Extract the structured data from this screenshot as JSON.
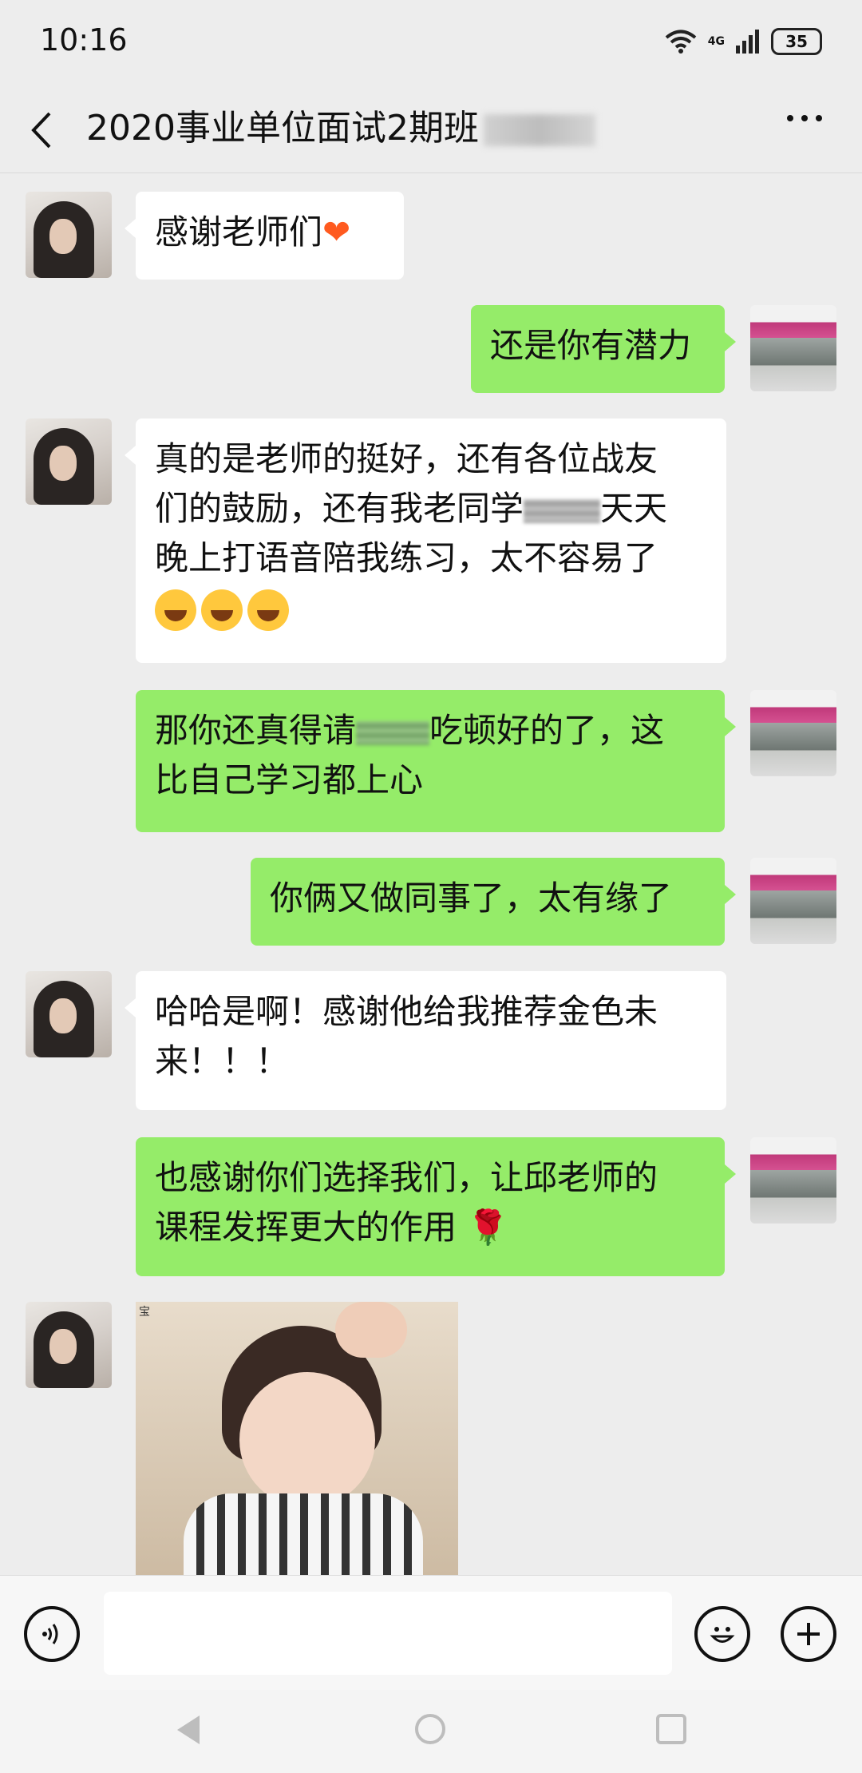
{
  "status_bar": {
    "time": "10:16",
    "network": "4G",
    "battery": "35"
  },
  "header": {
    "title": "2020事业单位面试2期班",
    "back_icon": "back-arrow-icon",
    "more_icon": "more-icon"
  },
  "messages": [
    {
      "side": "left",
      "text": "感谢老师们",
      "emoji": "orange-heart"
    },
    {
      "side": "right",
      "text": "还是你有潜力"
    },
    {
      "side": "left",
      "lines": [
        "真的是老师的挺好，还有各位战友",
        "们的鼓励，还有我老同学",
        "天天",
        "晚上打语音陪我练习，太不容易了"
      ],
      "emoji": "tears-of-joy x3"
    },
    {
      "side": "right",
      "lines": [
        "那你还真得请",
        "吃顿好的了，这",
        "比自己学习都上心"
      ]
    },
    {
      "side": "right",
      "text": "你俩又做同事了，太有缘了"
    },
    {
      "side": "left",
      "lines": [
        "哈哈是啊！感谢他给我推荐金色未",
        "来！！！"
      ]
    },
    {
      "side": "right",
      "lines": [
        "也感谢你们选择我们，让邱老师的",
        "课程发挥更大的作用"
      ],
      "emoji": "rose"
    },
    {
      "side": "left",
      "type": "sticker",
      "sticker_tag": "宝"
    }
  ],
  "input_bar": {
    "voice_icon": "voice-icon",
    "emoji_icon": "smiley-icon",
    "plus_icon": "plus-icon"
  },
  "colors": {
    "background": "#ededed",
    "self_bubble": "#95ec69",
    "other_bubble": "#ffffff"
  }
}
